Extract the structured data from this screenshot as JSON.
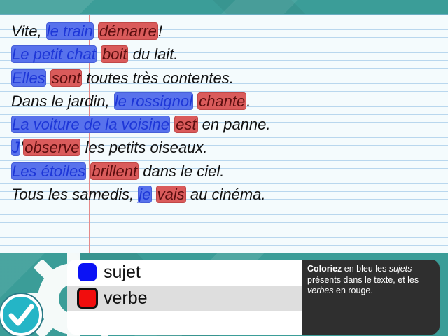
{
  "sentences": [
    {
      "segments": [
        {
          "text": "Vite, ",
          "role": "plain"
        },
        {
          "text": "le train",
          "role": "subject"
        },
        {
          "text": " ",
          "role": "plain"
        },
        {
          "text": "démarre",
          "role": "verb"
        },
        {
          "text": "!",
          "role": "plain"
        }
      ]
    },
    {
      "segments": [
        {
          "text": "Le petit chat",
          "role": "subject"
        },
        {
          "text": " ",
          "role": "plain"
        },
        {
          "text": "boit",
          "role": "verb"
        },
        {
          "text": " du lait.",
          "role": "plain"
        }
      ]
    },
    {
      "segments": [
        {
          "text": "Elles",
          "role": "subject"
        },
        {
          "text": " ",
          "role": "plain"
        },
        {
          "text": "sont",
          "role": "verb"
        },
        {
          "text": " toutes très contentes.",
          "role": "plain"
        }
      ]
    },
    {
      "segments": [
        {
          "text": "Dans le jardin, ",
          "role": "plain"
        },
        {
          "text": "le rossignol",
          "role": "subject"
        },
        {
          "text": " ",
          "role": "plain"
        },
        {
          "text": "chante",
          "role": "verb"
        },
        {
          "text": ".",
          "role": "plain"
        }
      ]
    },
    {
      "segments": [
        {
          "text": "La voiture de la voisine",
          "role": "subject"
        },
        {
          "text": " ",
          "role": "plain"
        },
        {
          "text": "est",
          "role": "verb"
        },
        {
          "text": " en panne.",
          "role": "plain"
        }
      ]
    },
    {
      "segments": [
        {
          "text": "J",
          "role": "subject"
        },
        {
          "text": "'",
          "role": "plain"
        },
        {
          "text": "observe",
          "role": "verb"
        },
        {
          "text": " les petits oiseaux.",
          "role": "plain"
        }
      ]
    },
    {
      "segments": [
        {
          "text": "Les étoiles",
          "role": "subject"
        },
        {
          "text": " ",
          "role": "plain"
        },
        {
          "text": "brillent",
          "role": "verb"
        },
        {
          "text": " dans le ciel.",
          "role": "plain"
        }
      ]
    },
    {
      "segments": [
        {
          "text": "Tous les samedis, ",
          "role": "plain"
        },
        {
          "text": "je",
          "role": "subject"
        },
        {
          "text": " ",
          "role": "plain"
        },
        {
          "text": "vais",
          "role": "verb"
        },
        {
          "text": " au cinéma.",
          "role": "plain"
        }
      ]
    }
  ],
  "legend": {
    "subject_label": "sujet",
    "verb_label": "verbe",
    "selected": "verbe"
  },
  "instructions": {
    "bold": "Coloriez",
    "part1": " en bleu les ",
    "subjects_word": "sujets",
    "part2": " présents dans le texte, et les ",
    "verbs_word": "verbes",
    "part3": " en rouge."
  },
  "colors": {
    "subject_highlight": "#5872ec",
    "verb_highlight": "#da5b5b",
    "subject_swatch": "#0b12f5",
    "verb_swatch": "#f10d0d",
    "background": "#3b9d98"
  },
  "icons": {
    "check_button": "checkmark-icon",
    "decoration": "gear-icon"
  }
}
